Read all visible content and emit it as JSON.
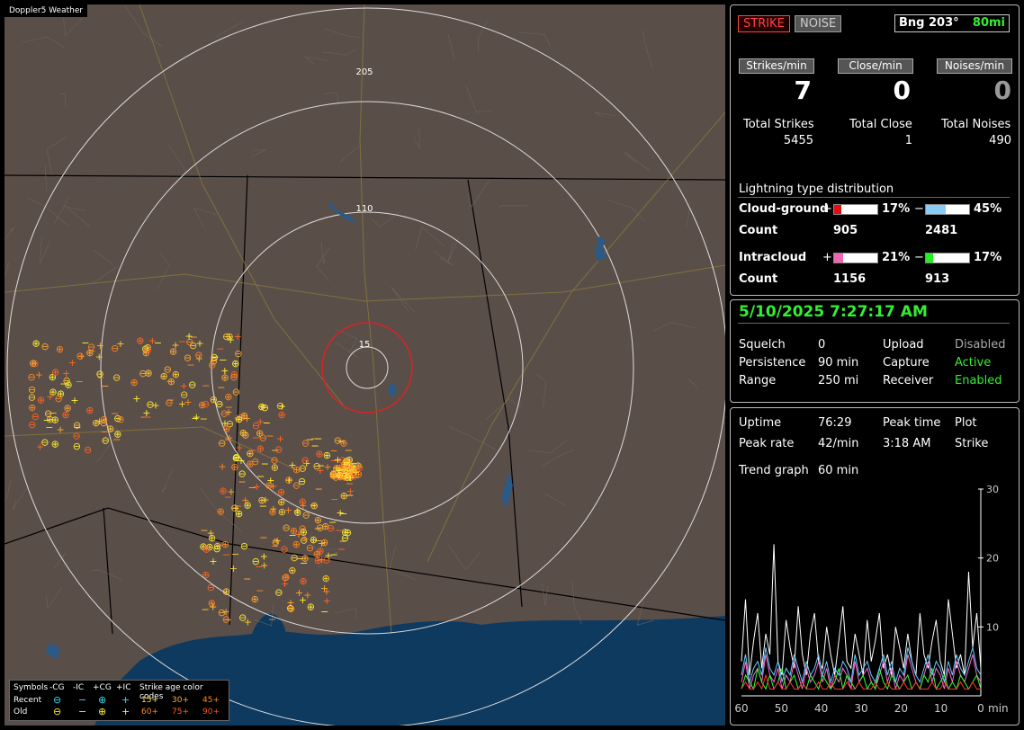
{
  "map": {
    "brand": "Doppler5 Weather",
    "ring_labels": [
      "205",
      "110",
      "15"
    ],
    "legend": {
      "headers": [
        "Symbols",
        "-CG",
        "-IC",
        "+CG",
        "+IC",
        "Strike age color codes"
      ],
      "recent_label": "Recent",
      "old_label": "Old",
      "age_codes_recent": [
        "15+",
        "30+",
        "45+"
      ],
      "age_codes_old": [
        "60+",
        "75+",
        "90+"
      ]
    }
  },
  "status": {
    "strike_btn": "STRIKE",
    "noise_btn": "NOISE",
    "bearing": "Bng 203°",
    "range_label": "80mi"
  },
  "rates": {
    "strikes_min_label": "Strikes/min",
    "close_min_label": "Close/min",
    "noises_min_label": "Noises/min",
    "strikes_min": "7",
    "close_min": "0",
    "noises_min": "0",
    "total_strikes_label": "Total Strikes",
    "total_close_label": "Total Close",
    "total_noises_label": "Total Noises",
    "total_strikes": "5455",
    "total_close": "1",
    "total_noises": "490"
  },
  "distribution": {
    "title": "Lightning type distribution",
    "cg_label": "Cloud-ground",
    "ic_label": "Intracloud",
    "count_label": "Count",
    "plus": "+",
    "minus": "−",
    "cg_pos_pct": "17%",
    "cg_neg_pct": "45%",
    "cg_pos_count": "905",
    "cg_neg_count": "2481",
    "ic_pos_pct": "21%",
    "ic_neg_pct": "17%",
    "ic_pos_count": "1156",
    "ic_neg_count": "913",
    "cg_pos_frac": 0.17,
    "cg_neg_frac": 0.45,
    "ic_pos_frac": 0.21,
    "ic_neg_frac": 0.17
  },
  "settings": {
    "datetime": "5/10/2025 7:27:17 AM",
    "squelch_label": "Squelch",
    "squelch": "0",
    "persistence_label": "Persistence",
    "persistence": "90 min",
    "range_label": "Range",
    "range": "250 mi",
    "upload_label": "Upload",
    "upload": "Disabled",
    "capture_label": "Capture",
    "capture": "Active",
    "receiver_label": "Receiver",
    "receiver": "Enabled"
  },
  "stats": {
    "uptime_label": "Uptime",
    "uptime": "76:29",
    "peak_time_label": "Peak time",
    "peak_time": "3:18 AM",
    "plot_label": "Plot",
    "peak_rate_label": "Peak rate",
    "peak_rate": "42/min",
    "peak_rate_time": "3:18 AM",
    "plot_value": "Strike",
    "trend_label": "Trend graph",
    "trend_value": "60 min"
  },
  "chart_data": {
    "type": "line",
    "x_ticks": [
      "60",
      "50",
      "40",
      "30",
      "20",
      "10",
      "0"
    ],
    "x_unit": "min",
    "y_ticks": [
      "30",
      "20",
      "10"
    ],
    "ylim": [
      0,
      30
    ],
    "xlim": [
      60,
      0
    ],
    "series": [
      {
        "color": "#ffffff",
        "values": [
          5,
          14,
          3,
          8,
          12,
          4,
          9,
          6,
          22,
          5,
          3,
          11,
          7,
          4,
          13,
          6,
          3,
          9,
          12,
          5,
          4,
          10,
          6,
          3,
          8,
          13,
          5,
          4,
          9,
          6,
          3,
          11,
          5,
          8,
          12,
          4,
          6,
          3,
          10,
          7,
          4,
          9,
          5,
          3,
          12,
          6,
          4,
          8,
          11,
          5,
          3,
          14,
          9,
          4,
          6,
          3,
          18,
          7,
          12,
          4
        ]
      },
      {
        "color": "#ff66cc",
        "values": [
          2,
          5,
          1,
          3,
          4,
          2,
          6,
          3,
          2,
          4,
          1,
          3,
          2,
          5,
          3,
          1,
          4,
          2,
          3,
          5,
          2,
          4,
          1,
          3,
          2,
          4,
          3,
          1,
          5,
          2,
          3,
          4,
          2,
          1,
          3,
          5,
          2,
          4,
          1,
          3,
          2,
          6,
          4,
          2,
          1,
          3,
          5,
          2,
          4,
          3,
          1,
          4,
          2,
          5,
          3,
          2,
          4,
          6,
          3,
          2
        ]
      },
      {
        "color": "#33ff33",
        "values": [
          1,
          3,
          2,
          1,
          4,
          2,
          1,
          3,
          1,
          2,
          4,
          1,
          2,
          3,
          1,
          2,
          1,
          3,
          2,
          1,
          3,
          2,
          1,
          2,
          4,
          1,
          3,
          2,
          1,
          2,
          3,
          1,
          2,
          1,
          4,
          2,
          1,
          3,
          2,
          1,
          2,
          3,
          1,
          2,
          1,
          3,
          2,
          4,
          1,
          2,
          3,
          1,
          2,
          1,
          3,
          2,
          1,
          2,
          3,
          1
        ]
      },
      {
        "color": "#ff3333",
        "values": [
          1,
          2,
          1,
          1,
          2,
          1,
          3,
          1,
          1,
          2,
          1,
          1,
          2,
          1,
          1,
          2,
          1,
          1,
          1,
          2,
          1,
          1,
          2,
          1,
          1,
          1,
          2,
          1,
          1,
          2,
          1,
          1,
          1,
          2,
          1,
          1,
          2,
          1,
          1,
          1,
          2,
          1,
          1,
          2,
          1,
          1,
          1,
          2,
          1,
          1,
          2,
          1,
          1,
          1,
          2,
          1,
          1,
          2,
          1,
          1
        ]
      },
      {
        "color": "#66ccff",
        "values": [
          3,
          6,
          2,
          4,
          5,
          3,
          7,
          4,
          3,
          5,
          2,
          4,
          3,
          6,
          4,
          2,
          5,
          3,
          4,
          6,
          3,
          5,
          2,
          4,
          3,
          5,
          4,
          2,
          6,
          3,
          4,
          5,
          3,
          2,
          4,
          6,
          3,
          5,
          2,
          4,
          3,
          7,
          5,
          3,
          2,
          4,
          6,
          3,
          5,
          4,
          2,
          5,
          3,
          6,
          4,
          3,
          5,
          7,
          4,
          3
        ]
      }
    ]
  }
}
